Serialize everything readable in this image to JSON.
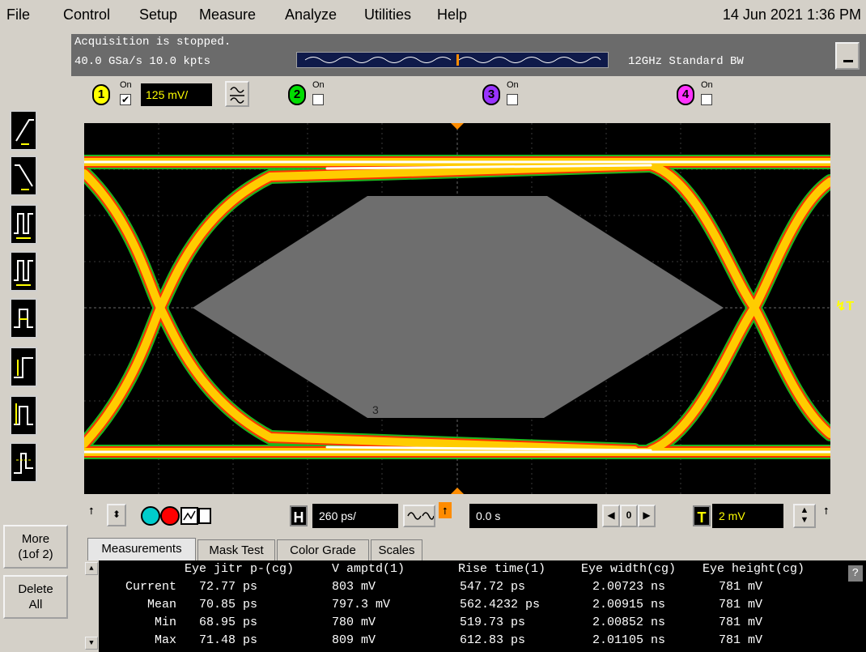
{
  "menubar": {
    "items": [
      "File",
      "Control",
      "Setup",
      "Measure",
      "Analyze",
      "Utilities",
      "Help"
    ],
    "datetime": "14 Jun 2021  1:36 PM"
  },
  "acquisition": {
    "status": "Acquisition is stopped.",
    "rate": "40.0 GSa/s   10.0 kpts",
    "bandwidth": "12GHz Standard BW"
  },
  "channels": [
    {
      "number": "1",
      "on_label": "On",
      "checked": true,
      "color": "#ffff00",
      "scale": "125 mV/"
    },
    {
      "number": "2",
      "on_label": "On",
      "checked": false,
      "color": "#00dd00"
    },
    {
      "number": "3",
      "on_label": "On",
      "checked": false,
      "color": "#9933ff"
    },
    {
      "number": "4",
      "on_label": "On",
      "checked": false,
      "color": "#ff33ff"
    }
  ],
  "left_toolbar": {
    "more_label": "More\n(1of 2)",
    "delete_label": "Delete\nAll"
  },
  "scope": {
    "mask_region_label": "3",
    "trigger_marker": "↯T"
  },
  "horizontal": {
    "h_badge": "H",
    "timebase": "260 ps/",
    "delay": "0.0 s",
    "nav_value": "0",
    "t_badge": "T",
    "trigger_level": "2 mV"
  },
  "tabs": [
    "Measurements",
    "Mask Test",
    "Color Grade",
    "Scales"
  ],
  "measurements": {
    "headers": [
      "Eye jitr p-(cg)",
      "V amptd(1)",
      "Rise time(1)",
      "Eye width(cg)",
      "Eye height(cg)"
    ],
    "rows": [
      {
        "label": "Current",
        "values": [
          "72.77 ps",
          "803 mV",
          "547.72 ps",
          "2.00723 ns",
          "781 mV"
        ]
      },
      {
        "label": "Mean",
        "values": [
          "70.85 ps",
          "797.3 mV",
          "562.4232 ps",
          "2.00915 ns",
          "781 mV"
        ]
      },
      {
        "label": "Min",
        "values": [
          "68.95 ps",
          "780 mV",
          "519.73 ps",
          "2.00852 ns",
          "781 mV"
        ]
      },
      {
        "label": "Max",
        "values": [
          "71.48 ps",
          "809 mV",
          "612.83 ps",
          "2.01105 ns",
          "781 mV"
        ]
      }
    ],
    "help_label": "?"
  }
}
